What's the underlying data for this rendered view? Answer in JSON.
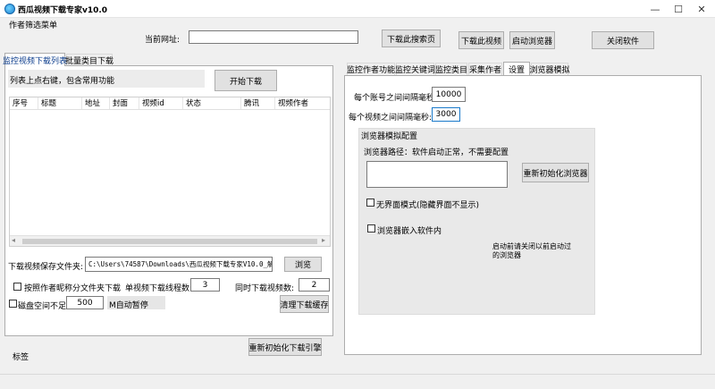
{
  "window": {
    "title": "西瓜视频下载专家v10.0",
    "minimize": "—",
    "maximize": "☐",
    "close": "✕"
  },
  "menu": {
    "item": "作者筛选菜单"
  },
  "top": {
    "url_label": "当前网址:",
    "url_value": "",
    "download_search_page": "下载此搜索页",
    "download_this_video": "下载此视频",
    "launch_browser": "启动浏览器",
    "close_software": "关闭软件"
  },
  "left_tabs": [
    "监控视频下载列表",
    "批量类目下载"
  ],
  "left": {
    "hint": "列表上点右键，包含常用功能",
    "start_download": "开始下载",
    "columns": [
      "序号",
      "标题",
      "地址",
      "封面",
      "视频id",
      "状态",
      "腾讯",
      "视频作者"
    ],
    "save_folder_label": "下载视频保存文件夹:",
    "save_folder_value": "C:\\Users\\74587\\Downloads\\西瓜视频下载专家V10.0_解析\\do",
    "browse": "浏览",
    "by_author_folder": "按照作者昵称分文件夹下载",
    "threads_label": "单视频下载线程数:",
    "threads_value": "3",
    "concurrent_label": "同时下载视频数:",
    "concurrent_value": "2",
    "disk_low_label": "磁盘空间不足",
    "disk_low_value": "500",
    "disk_low_suffix": "M自动暂停",
    "clear_cache": "清理下载缓存",
    "reinit_engine": "重新初始化下载引擎",
    "tag_label": "标签"
  },
  "right_tabs": [
    "监控作者功能",
    "监控关键词",
    "监控类目",
    "采集作者",
    "设置",
    "浏览器模拟"
  ],
  "settings": {
    "account_interval_label": "每个账号之间间隔毫秒:",
    "account_interval_value": "10000",
    "video_interval_label": "每个视频之间间隔毫秒:",
    "video_interval_value": "3000",
    "browser_config_title": "浏览器模拟配置",
    "browser_path_label": "浏览器路径：软件启动正常，不需要配置",
    "reinit_browser": "重新初始化浏览器",
    "headless_label": "无界面模式(隐藏界面不显示)",
    "embed_label": "浏览器嵌入软件内",
    "restart_note": "启动前请关闭以前启动过的浏览器"
  }
}
